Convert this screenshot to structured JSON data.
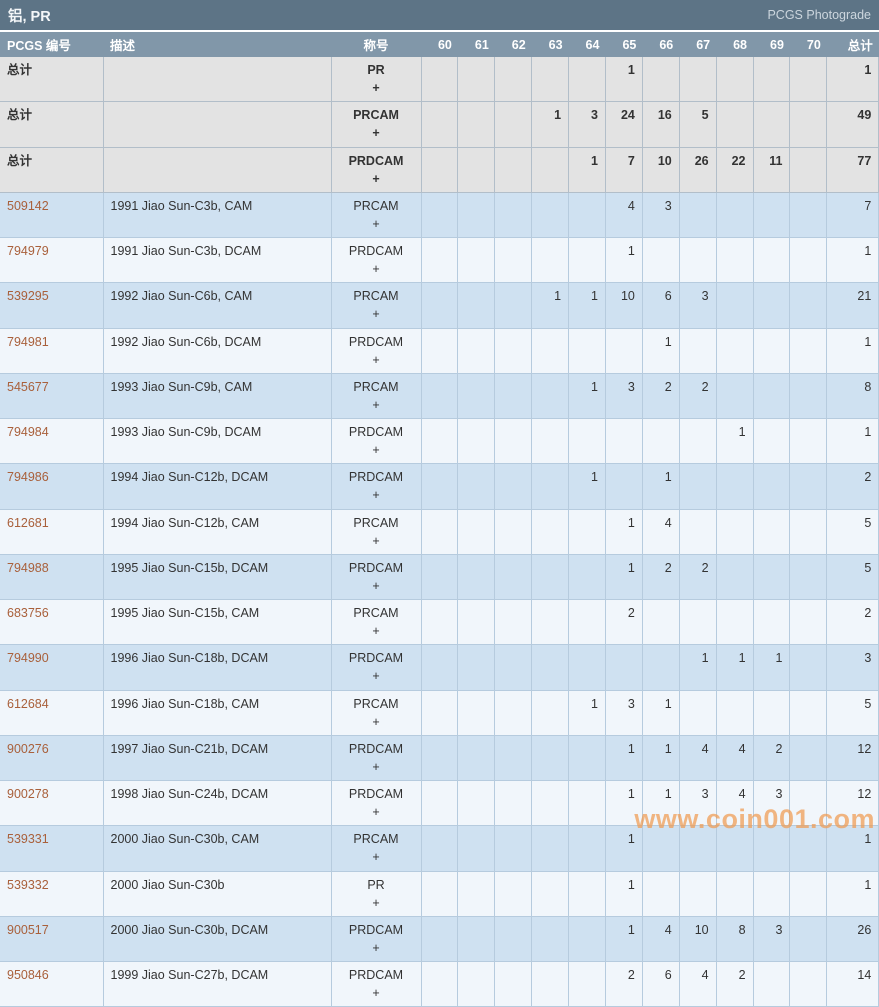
{
  "header": {
    "title": "铝, PR",
    "photograde_label": "PCGS Photograde"
  },
  "table": {
    "headers": {
      "pcgs": "PCGS 编号",
      "description": "描述",
      "designation": "称号",
      "grades": [
        "60",
        "61",
        "62",
        "63",
        "64",
        "65",
        "66",
        "67",
        "68",
        "69",
        "70"
      ],
      "total": "总计"
    },
    "summary_rows": [
      {
        "label": "总计",
        "designation": "PR",
        "plus": "+",
        "grades": [
          "",
          "",
          "",
          "",
          "",
          "1",
          "",
          "",
          "",
          "",
          ""
        ],
        "total": "1"
      },
      {
        "label": "总计",
        "designation": "PRCAM",
        "plus": "+",
        "grades": [
          "",
          "",
          "",
          "1",
          "3",
          "24",
          "16",
          "5",
          "",
          "",
          ""
        ],
        "total": "49"
      },
      {
        "label": "总计",
        "designation": "PRDCAM",
        "plus": "+",
        "grades": [
          "",
          "",
          "",
          "",
          "1",
          "7",
          "10",
          "26",
          "22",
          "11",
          ""
        ],
        "total": "77"
      }
    ],
    "rows": [
      {
        "pcgs": "509142",
        "description": "1991 Jiao Sun-C3b, CAM",
        "designation": "PRCAM",
        "plus": "+",
        "grades": [
          "",
          "",
          "",
          "",
          "",
          "4",
          "3",
          "",
          "",
          "",
          ""
        ],
        "total": "7"
      },
      {
        "pcgs": "794979",
        "description": "1991 Jiao Sun-C3b, DCAM",
        "designation": "PRDCAM",
        "plus": "+",
        "grades": [
          "",
          "",
          "",
          "",
          "",
          "1",
          "",
          "",
          "",
          "",
          ""
        ],
        "total": "1"
      },
      {
        "pcgs": "539295",
        "description": "1992 Jiao Sun-C6b, CAM",
        "designation": "PRCAM",
        "plus": "+",
        "grades": [
          "",
          "",
          "",
          "1",
          "1",
          "10",
          "6",
          "3",
          "",
          "",
          ""
        ],
        "total": "21"
      },
      {
        "pcgs": "794981",
        "description": "1992 Jiao Sun-C6b, DCAM",
        "designation": "PRDCAM",
        "plus": "+",
        "grades": [
          "",
          "",
          "",
          "",
          "",
          "",
          "1",
          "",
          "",
          "",
          ""
        ],
        "total": "1"
      },
      {
        "pcgs": "545677",
        "description": "1993 Jiao Sun-C9b, CAM",
        "designation": "PRCAM",
        "plus": "+",
        "grades": [
          "",
          "",
          "",
          "",
          "1",
          "3",
          "2",
          "2",
          "",
          "",
          ""
        ],
        "total": "8"
      },
      {
        "pcgs": "794984",
        "description": "1993 Jiao Sun-C9b, DCAM",
        "designation": "PRDCAM",
        "plus": "+",
        "grades": [
          "",
          "",
          "",
          "",
          "",
          "",
          "",
          "",
          "1",
          "",
          ""
        ],
        "total": "1"
      },
      {
        "pcgs": "794986",
        "description": "1994 Jiao Sun-C12b, DCAM",
        "designation": "PRDCAM",
        "plus": "+",
        "grades": [
          "",
          "",
          "",
          "",
          "1",
          "",
          "1",
          "",
          "",
          "",
          ""
        ],
        "total": "2"
      },
      {
        "pcgs": "612681",
        "description": "1994 Jiao Sun-C12b, CAM",
        "designation": "PRCAM",
        "plus": "+",
        "grades": [
          "",
          "",
          "",
          "",
          "",
          "1",
          "4",
          "",
          "",
          "",
          ""
        ],
        "total": "5"
      },
      {
        "pcgs": "794988",
        "description": "1995 Jiao Sun-C15b, DCAM",
        "designation": "PRDCAM",
        "plus": "+",
        "grades": [
          "",
          "",
          "",
          "",
          "",
          "1",
          "2",
          "2",
          "",
          "",
          ""
        ],
        "total": "5"
      },
      {
        "pcgs": "683756",
        "description": "1995 Jiao Sun-C15b, CAM",
        "designation": "PRCAM",
        "plus": "+",
        "grades": [
          "",
          "",
          "",
          "",
          "",
          "2",
          "",
          "",
          "",
          "",
          ""
        ],
        "total": "2"
      },
      {
        "pcgs": "794990",
        "description": "1996 Jiao Sun-C18b, DCAM",
        "designation": "PRDCAM",
        "plus": "+",
        "grades": [
          "",
          "",
          "",
          "",
          "",
          "",
          "",
          "1",
          "1",
          "1",
          ""
        ],
        "total": "3"
      },
      {
        "pcgs": "612684",
        "description": "1996 Jiao Sun-C18b, CAM",
        "designation": "PRCAM",
        "plus": "+",
        "grades": [
          "",
          "",
          "",
          "",
          "1",
          "3",
          "1",
          "",
          "",
          "",
          ""
        ],
        "total": "5"
      },
      {
        "pcgs": "900276",
        "description": "1997 Jiao Sun-C21b, DCAM",
        "designation": "PRDCAM",
        "plus": "+",
        "grades": [
          "",
          "",
          "",
          "",
          "",
          "1",
          "1",
          "4",
          "4",
          "2",
          ""
        ],
        "total": "12"
      },
      {
        "pcgs": "900278",
        "description": "1998 Jiao Sun-C24b, DCAM",
        "designation": "PRDCAM",
        "plus": "+",
        "grades": [
          "",
          "",
          "",
          "",
          "",
          "1",
          "1",
          "3",
          "4",
          "3",
          ""
        ],
        "total": "12"
      },
      {
        "pcgs": "539331",
        "description": "2000 Jiao Sun-C30b, CAM",
        "designation": "PRCAM",
        "plus": "+",
        "grades": [
          "",
          "",
          "",
          "",
          "",
          "1",
          "",
          "",
          "",
          "",
          ""
        ],
        "total": "1"
      },
      {
        "pcgs": "539332",
        "description": "2000 Jiao Sun-C30b",
        "designation": "PR",
        "plus": "+",
        "grades": [
          "",
          "",
          "",
          "",
          "",
          "1",
          "",
          "",
          "",
          "",
          ""
        ],
        "total": "1"
      },
      {
        "pcgs": "900517",
        "description": "2000 Jiao Sun-C30b, DCAM",
        "designation": "PRDCAM",
        "plus": "+",
        "grades": [
          "",
          "",
          "",
          "",
          "",
          "1",
          "4",
          "10",
          "8",
          "3",
          ""
        ],
        "total": "26"
      },
      {
        "pcgs": "950846",
        "description": "1999 Jiao Sun-C27b, DCAM",
        "designation": "PRDCAM",
        "plus": "+",
        "grades": [
          "",
          "",
          "",
          "",
          "",
          "2",
          "6",
          "4",
          "2",
          "",
          ""
        ],
        "total": "14"
      }
    ]
  },
  "watermark": "www.coin001.com",
  "colors": {
    "titlebar_bg": "#5d7486",
    "header_bg": "#8197a9",
    "summary_bg": "#e3e3e3",
    "row_blue": "#cfe1f1",
    "row_light": "#f1f6fb",
    "link": "#a9603b",
    "watermark": "#f09b52",
    "border_data": "#b6cbde",
    "border_summary": "#b2bec9"
  }
}
